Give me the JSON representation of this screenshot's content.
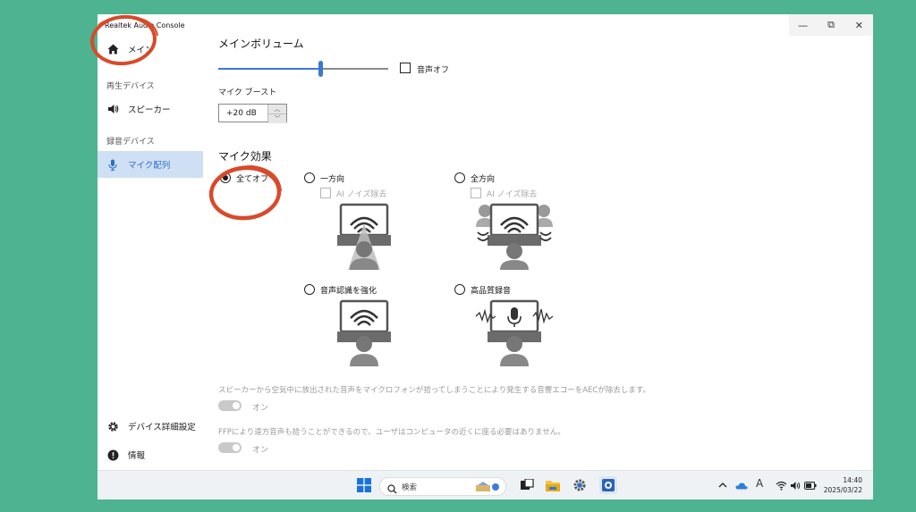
{
  "app": {
    "title": "Realtek Audio Console"
  },
  "window_controls": {
    "minimize": "—",
    "restore": "⧉",
    "close": "✕"
  },
  "sidebar": {
    "main_item": "メイン",
    "playback_section": "再生デバイス",
    "speaker_item": "スピーカー",
    "recording_section": "録音デバイス",
    "mic_array_item": "マイク配列",
    "device_settings_item": "デバイス詳細設定",
    "info_item": "情報"
  },
  "main": {
    "volume_title": "メインボリューム",
    "volume_level": 0.6,
    "mute_label": "音声オフ",
    "mic_boost_label": "マイク ブースト",
    "mic_boost_value": "+20 dB",
    "mic_effects_title": "マイク効果",
    "options": {
      "all_off": "全てオフ",
      "one_direction": "一方向",
      "omni": "全方向",
      "speech_enhance": "音声認識を強化",
      "hq_recording": "高品質録音"
    },
    "ai_noise_label": "AI ノイズ除去",
    "aec_description": "スピーカーから空気中に放出された音声をマイクロフォンが拾ってしまうことにより発生する音響エコーをAECが除去します。",
    "aec_toggle": "オン",
    "ffp_description": "FFPにより遠方音声も拾うことができるので、ユーザはコンピュータの近くに座る必要はありません。",
    "ffp_toggle": "オン"
  },
  "taskbar": {
    "search_placeholder": "検索",
    "time": "14:40",
    "date": "2025/03/22",
    "ime": "A"
  },
  "colors": {
    "accent": "#3b78d0",
    "background": "#4db391",
    "annotation": "#d84a2b"
  }
}
